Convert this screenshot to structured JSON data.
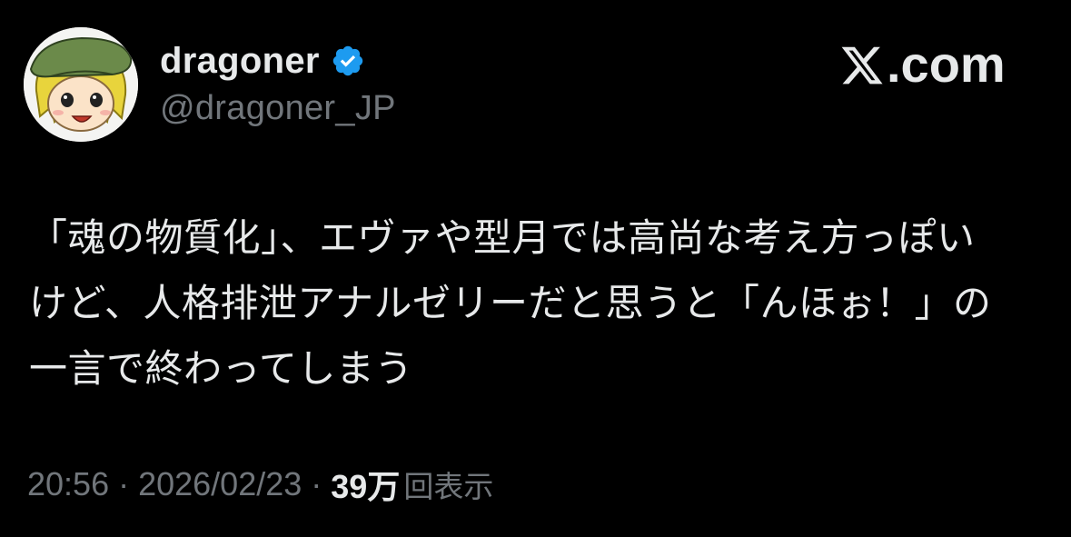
{
  "author": {
    "display_name": "dragoner",
    "handle": "@dragoner_JP",
    "verified_icon": "verified-badge-icon",
    "avatar_icon": "yukkuri-avatar"
  },
  "brand": {
    "text": ".com",
    "logo_icon": "x-logo-icon"
  },
  "tweet": {
    "lines": [
      "「魂の物質化」、エヴァや型月では高尚な考え方っぽい",
      "けど、人格排泄アナルゼリーだと思うと「んほぉ！」の",
      "一言で終わってしまう"
    ]
  },
  "meta": {
    "time": "20:56",
    "date": "2026/02/23",
    "separator": "·",
    "views_count": "39万",
    "views_label": "回表示"
  },
  "colors": {
    "background": "#000000",
    "primary_text": "#e7e9ea",
    "secondary_text": "#71767b",
    "verified_blue": "#1d9bf0"
  }
}
